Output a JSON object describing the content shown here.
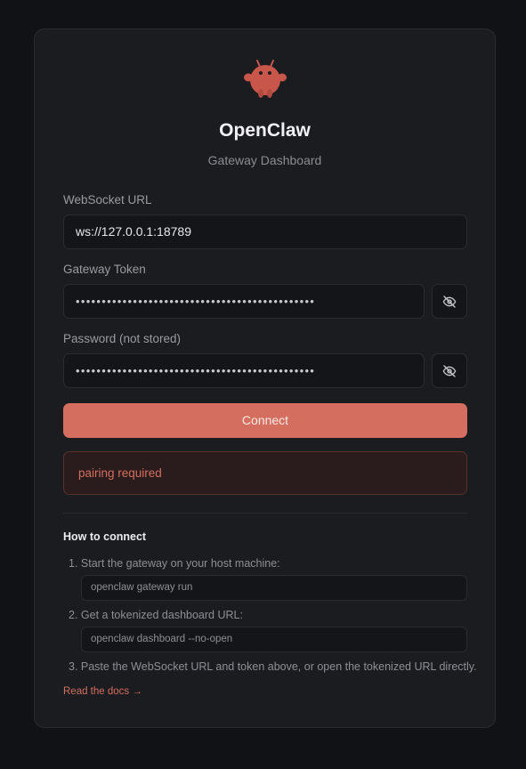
{
  "app": {
    "title": "OpenClaw",
    "subtitle": "Gateway Dashboard",
    "logo_icon": "crab-mascot-icon"
  },
  "form": {
    "websocket_label": "WebSocket URL",
    "websocket_value": "ws://127.0.0.1:18789",
    "token_label": "Gateway Token",
    "token_value": "••••••••••••••••••••••••••••••••••••••••••••••",
    "password_label": "Password (not stored)",
    "password_value": "••••••••••••••••••••••••••••••••••••••••••••••",
    "toggle_icon": "eye-off-icon",
    "connect_label": "Connect"
  },
  "status": {
    "message": "pairing required"
  },
  "howto": {
    "title": "How to connect",
    "steps": [
      "1. Start the gateway on your host machine:",
      "2. Get a tokenized dashboard URL:",
      "3. Paste the WebSocket URL and token above, or open the tokenized URL directly."
    ],
    "commands": [
      "openclaw gateway run",
      "openclaw dashboard --no-open"
    ],
    "docs_link": "Read the docs →"
  },
  "colors": {
    "accent": "#d46f5f",
    "background": "#111215",
    "card": "#1b1c20",
    "error_bg": "#2a1c1d"
  }
}
